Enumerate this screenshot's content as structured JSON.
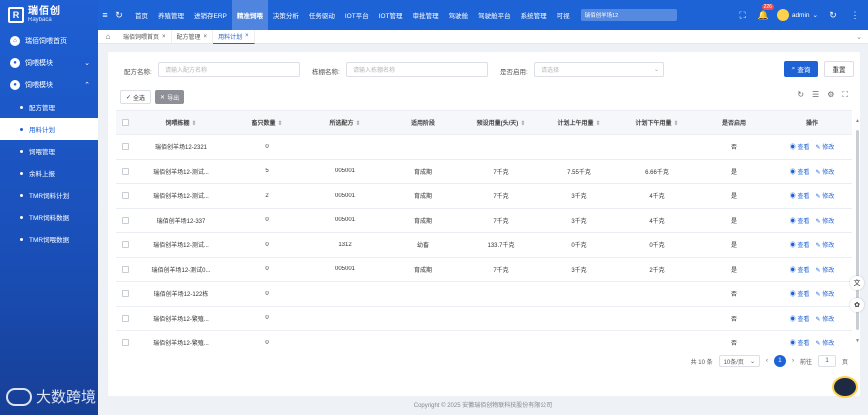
{
  "brand": {
    "name_cn": "瑞佰创",
    "name_en": "Raybaca"
  },
  "watermark": "大数跨境",
  "sidebar": {
    "items": [
      {
        "label": "瑞佰饲喂首页",
        "type": "top"
      },
      {
        "label": "饲喂模块",
        "type": "top",
        "chev": "⌄"
      },
      {
        "label": "饲喂模块",
        "type": "top",
        "chev": "⌃"
      }
    ],
    "sub_items": [
      {
        "label": "配方管理"
      },
      {
        "label": "用料计划",
        "active": true
      },
      {
        "label": "饲喂管理"
      },
      {
        "label": "余料上报"
      },
      {
        "label": "TMR饲料计划"
      },
      {
        "label": "TMR饲料数据"
      },
      {
        "label": "TMR饲喂数据"
      }
    ]
  },
  "topnav": {
    "items": [
      "首页",
      "养殖管理",
      "进销存ERP",
      "精准饲喂",
      "决策分析",
      "任务驱动",
      "IOT平台",
      "IOT管理",
      "审批管理",
      "驾驶舱",
      "驾驶舱平台",
      "系统管理",
      "可视"
    ],
    "active_index": 3,
    "search_value": "瑞佰创羊场12",
    "notify_count": "226",
    "user": "admin"
  },
  "tabs": [
    {
      "label": "瑞佰饲喂首页",
      "close": "×"
    },
    {
      "label": "配方管理",
      "close": "×"
    },
    {
      "label": "用料计划",
      "close": "×",
      "active": true
    }
  ],
  "filters": {
    "formula_label": "配方名称:",
    "formula_placeholder": "请输入配方名称",
    "pen_label": "栋棚名称:",
    "pen_placeholder": "请输入栋棚名称",
    "enabled_label": "是否启用:",
    "enabled_placeholder": "请选择",
    "query": "查询",
    "reset": "重置"
  },
  "actions": {
    "select_all": "全选",
    "export": "导出"
  },
  "table": {
    "headers": [
      "饲喂栋棚",
      "畜只数量",
      "所选配方",
      "适用阶段",
      "预设用量(头/天)",
      "计划上午用量",
      "计划下午用量",
      "是否启用",
      "操作"
    ],
    "view_label": "查看",
    "edit_label": "修改",
    "rows": [
      [
        "瑞佰创羊场12-2321",
        "0",
        "",
        "",
        "",
        "",
        "",
        "否"
      ],
      [
        "瑞佰创羊场12-测试...",
        "5",
        "005001",
        "育成期",
        "7千克",
        "7.55千克",
        "6.66千克",
        "是"
      ],
      [
        "瑞佰创羊场12-测试...",
        "2",
        "005001",
        "育成期",
        "7千克",
        "3千克",
        "4千克",
        "是"
      ],
      [
        "瑞佰创羊场12-337",
        "0",
        "005001",
        "育成期",
        "7千克",
        "3千克",
        "4千克",
        "是"
      ],
      [
        "瑞佰创羊场12-测试...",
        "0",
        "1312",
        "幼畜",
        "133.7千克",
        "0千克",
        "0千克",
        "是"
      ],
      [
        "瑞佰创羊场12-测试0...",
        "0",
        "005001",
        "育成期",
        "7千克",
        "3千克",
        "2千克",
        "是"
      ],
      [
        "瑞佰创羊场12-122栋",
        "0",
        "",
        "",
        "",
        "",
        "",
        "否"
      ],
      [
        "瑞佰创羊场12-繁殖...",
        "0",
        "",
        "",
        "",
        "",
        "",
        "否"
      ],
      [
        "瑞佰创羊场12-繁殖...",
        "0",
        "",
        "",
        "",
        "",
        "",
        "否"
      ]
    ]
  },
  "pager": {
    "total": "共 10 条",
    "size": "10条/页",
    "page": "1",
    "goto_label": "前往",
    "goto_value": "1",
    "goto_suffix": "页"
  },
  "footer": "Copyright © 2025 安徽瑞佰创物联科技股份有限公司",
  "colors": {
    "primary": "#1e63d6",
    "sidebar": "#1e5fd3"
  }
}
